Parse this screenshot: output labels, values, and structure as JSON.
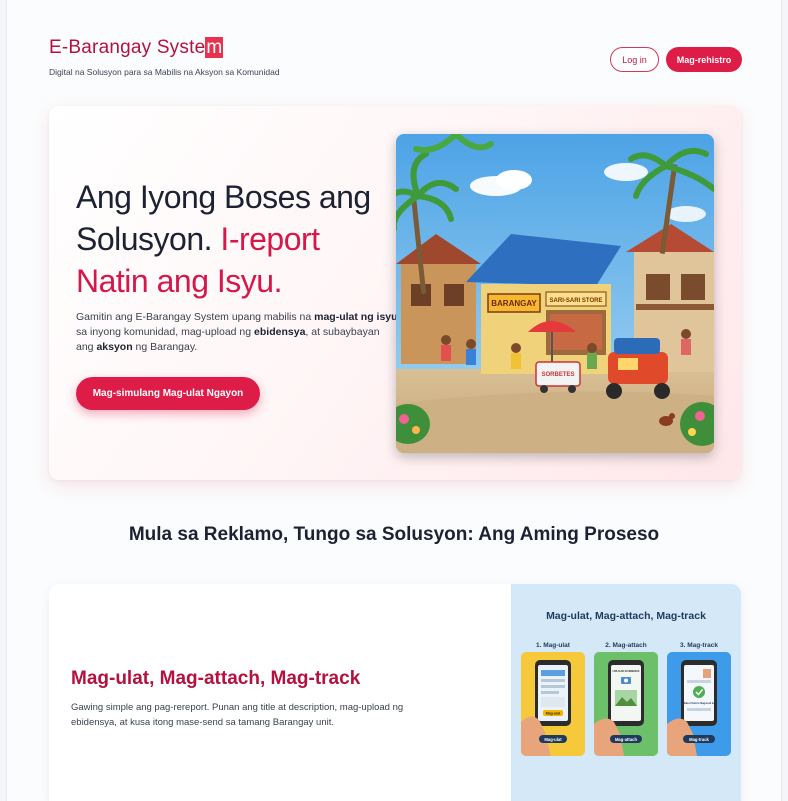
{
  "header": {
    "brand_prefix": "E-Barangay Syste",
    "brand_highlight": "m",
    "tagline": "Digital na Solusyon para sa Mabilis na Aksyon sa Komunidad",
    "login_label": "Log in",
    "register_label": "Mag-rehistro"
  },
  "hero": {
    "title_part1": "Ang Iyong Boses ang Solusyon.",
    "title_accent": "I-report Natin ang Isyu.",
    "desc_1": "Gamitin ang E-Barangay System upang mabilis na ",
    "desc_b1": "mag-ulat ng isyu",
    "desc_2": " sa inyong komunidad, mag-upload ng ",
    "desc_b2": "ebidensya",
    "desc_3": ", at subaybayan ang ",
    "desc_b3": "aksyon",
    "desc_4": " ng Barangay.",
    "cta_label": "Mag-simulang Mag-ulat Ngayon",
    "image": {
      "sign_barangay": "BARANGAY",
      "sign_store": "SARI-SARI STORE",
      "sign_cart": "SORBETES"
    }
  },
  "process": {
    "section_title": "Mula sa Reklamo, Tungo sa Solusyon: Ang Aming Proseso",
    "feature_title": "Mag-ulat, Mag-attach, Mag-track",
    "feature_desc": "Gawing simple ang pag-rereport. Punan ang title at description, mag-upload ng ebidensya, at kusa itong mase-send sa tamang Barangay unit.",
    "panel_title": "Mag-ulat, Mag-attach, Mag-track",
    "steps": [
      {
        "label": "1. Mag-ulat",
        "button": "Mag-ulat",
        "screen_btn": "Mag-ulat",
        "color": "#f6c93b"
      },
      {
        "label": "2. Mag-attach",
        "button": "Mag-attach",
        "screen_text": "UPLOAD EVIDENCE",
        "color": "#6cc06a"
      },
      {
        "label": "3. Mag-track",
        "button": "Mag-track",
        "screen_text": "Mabot Sunrio Nagsend bo",
        "color": "#3d9be9"
      }
    ]
  },
  "colors": {
    "brand": "#b3123f",
    "accent": "#dd1c48",
    "panel_bg": "#d4e8f7"
  }
}
